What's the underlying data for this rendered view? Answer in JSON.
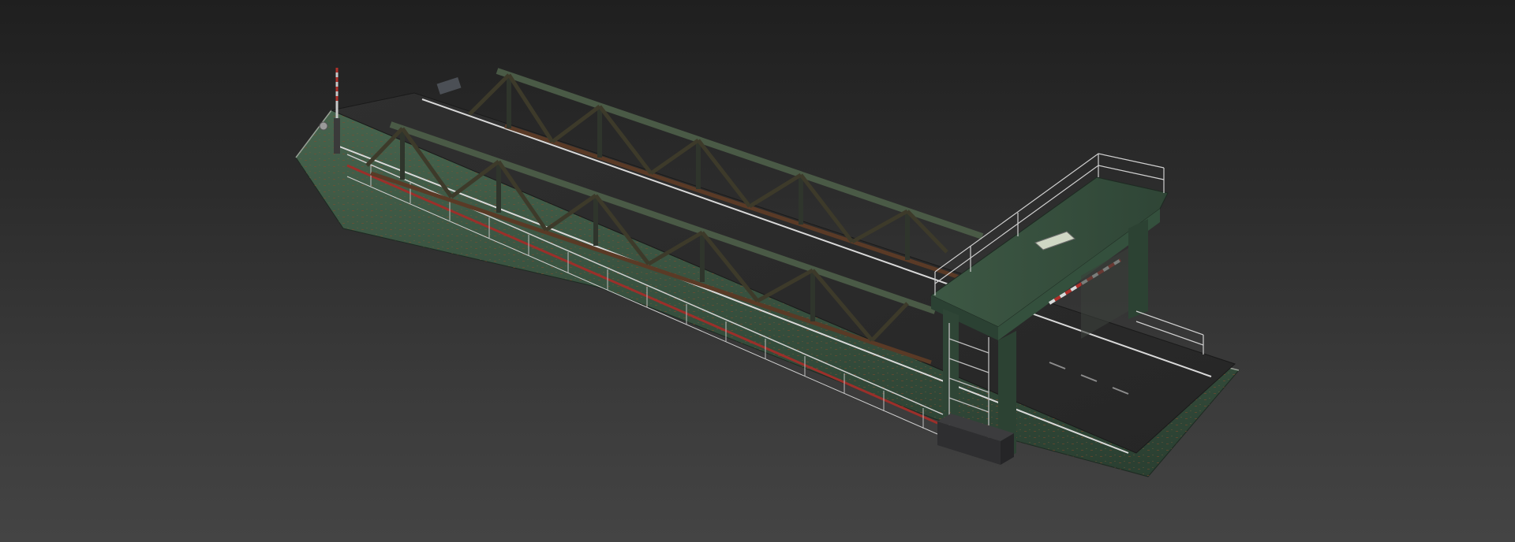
{
  "scene": {
    "subject": "ferry-ramp-bridge-model",
    "colors": {
      "background_top": "#1f1f1f",
      "background_bottom": "#444444",
      "hull_green": "#3e5a45",
      "hull_green_dark": "#2b4133",
      "deck_asphalt": "#2b2b2b",
      "truss_steel": "#3a3f35",
      "rust": "#8a4a2a",
      "rail_red": "#9c2f2a",
      "rail_white": "#d9d9d9",
      "base_block": "#2e2e30"
    }
  }
}
